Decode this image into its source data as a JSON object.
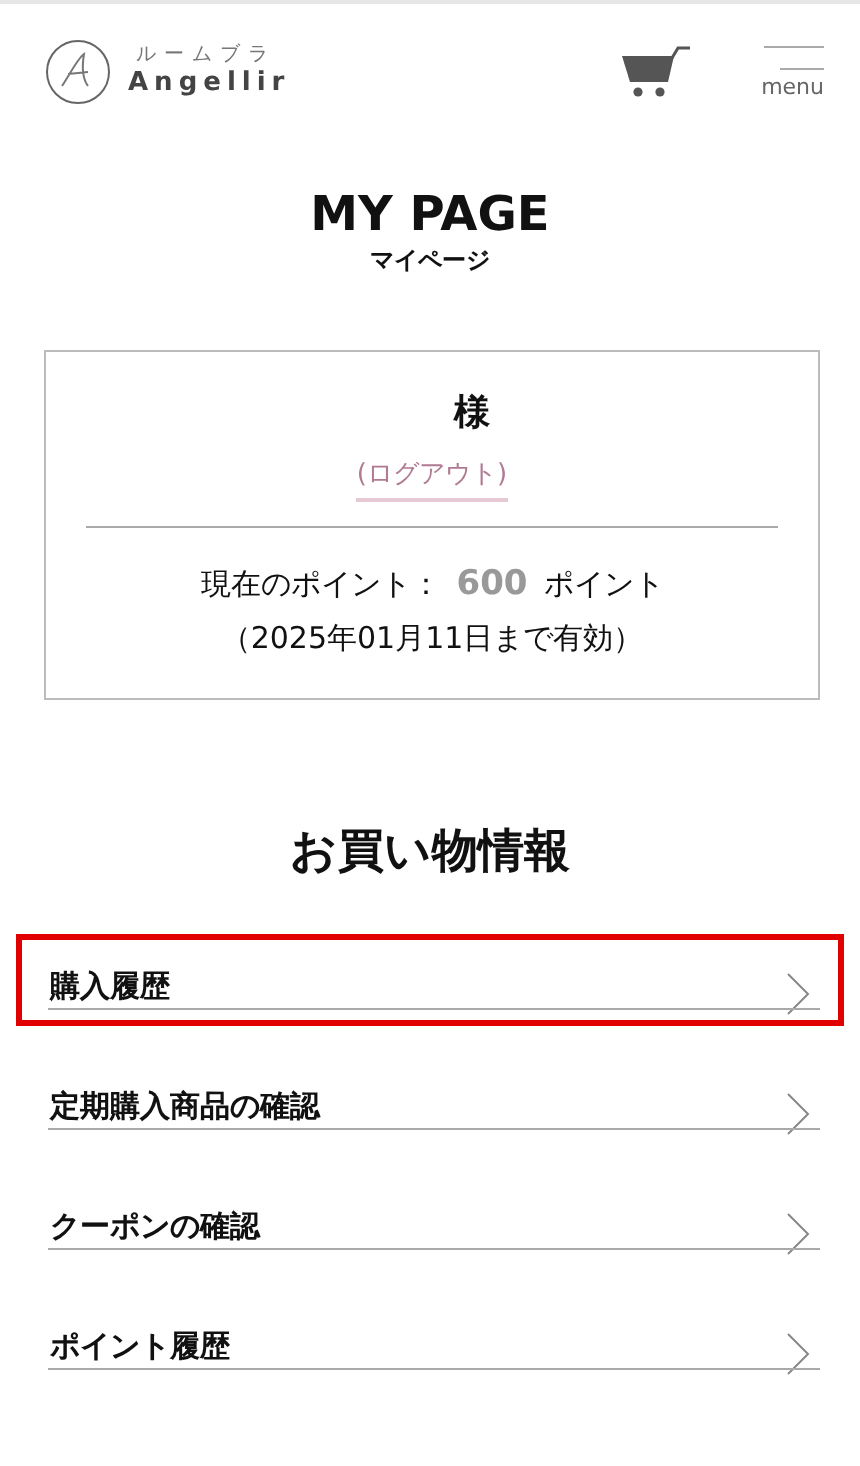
{
  "header": {
    "logo_kana": "ルームブラ",
    "logo_name": "Angellir",
    "menu_label": "menu"
  },
  "page_title": {
    "main": "MY PAGE",
    "sub": "マイページ"
  },
  "account": {
    "honorific": "様",
    "logout": "(ログアウト)",
    "points_label": "現在のポイント：",
    "points_value": "600",
    "points_unit": "ポイント",
    "expiry": "（2025年01月11日まで有効）"
  },
  "section_title": "お買い物情報",
  "items": [
    {
      "label": "購入履歴",
      "highlighted": true
    },
    {
      "label": "定期購入商品の確認",
      "highlighted": false
    },
    {
      "label": "クーポンの確認",
      "highlighted": false
    },
    {
      "label": "ポイント履歴",
      "highlighted": false
    }
  ]
}
